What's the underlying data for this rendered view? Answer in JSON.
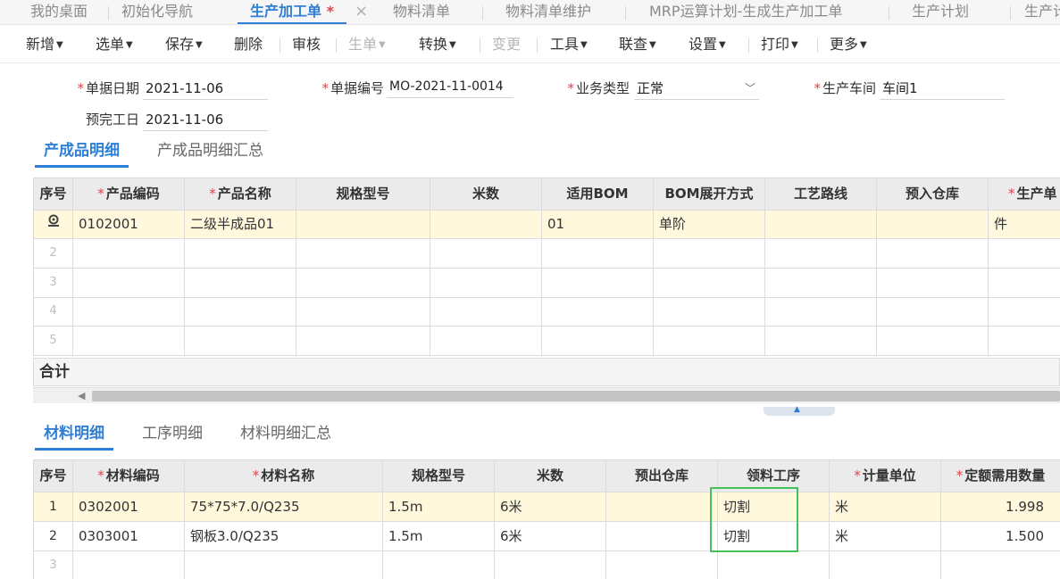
{
  "tabs": [
    {
      "label": "我的桌面",
      "active": false
    },
    {
      "label": "初始化导航",
      "active": false
    },
    {
      "label": "生产加工单",
      "active": true,
      "dirty_mark": "*"
    },
    {
      "label": "物料清单",
      "active": false
    },
    {
      "label": "物料清单维护",
      "active": false
    },
    {
      "label": "MRP运算计划-生成生产加工单",
      "active": false
    },
    {
      "label": "生产计划",
      "active": false
    },
    {
      "label": "生产计",
      "active": false
    }
  ],
  "tab_close_glyph": "×",
  "toolbar": {
    "new": "新增",
    "select_doc": "选单",
    "save": "保存",
    "delete": "删除",
    "audit": "审核",
    "generate": "生单",
    "convert": "转换",
    "change": "变更",
    "tools": "工具",
    "link_query": "联查",
    "settings": "设置",
    "print": "打印",
    "more": "更多"
  },
  "form": {
    "doc_date": {
      "label": "单据日期",
      "value": "2021-11-06"
    },
    "doc_no": {
      "label": "单据编号",
      "value": "MO-2021-11-0014"
    },
    "biz_type": {
      "label": "业务类型",
      "value": "正常"
    },
    "workshop": {
      "label": "生产车间",
      "value": "车间1"
    },
    "due_date": {
      "label": "预完工日",
      "value": "2021-11-06"
    }
  },
  "product_tabs": [
    "产成品明细",
    "产成品明细汇总"
  ],
  "product_grid": {
    "headers": [
      "序号",
      "产品编码",
      "产品名称",
      "规格型号",
      "米数",
      "适用BOM",
      "BOM展开方式",
      "工艺路线",
      "预入仓库",
      "生产单"
    ],
    "rows": [
      {
        "seq": "",
        "code": "0102001",
        "name": "二级半成品01",
        "spec": "",
        "meters": "",
        "bom": "01",
        "bom_mode": "单阶",
        "route": "",
        "warehouse": "",
        "unit": "件"
      },
      {
        "seq": "2"
      },
      {
        "seq": "3"
      },
      {
        "seq": "4"
      },
      {
        "seq": "5"
      }
    ],
    "total_label": "合计"
  },
  "material_tabs": [
    "材料明细",
    "工序明细",
    "材料明细汇总"
  ],
  "material_grid": {
    "headers": [
      "序号",
      "材料编码",
      "材料名称",
      "规格型号",
      "米数",
      "预出仓库",
      "领料工序",
      "计量单位",
      "定额需用数量"
    ],
    "rows": [
      {
        "seq": "1",
        "code": "0302001",
        "name": "75*75*7.0/Q235",
        "spec": "1.5m",
        "meters": "6米",
        "warehouse": "",
        "process": "切割",
        "unit": "米",
        "qty": "1.998"
      },
      {
        "seq": "2",
        "code": "0303001",
        "name": "钢板3.0/Q235",
        "spec": "1.5m",
        "meters": "6米",
        "warehouse": "",
        "process": "切割",
        "unit": "米",
        "qty": "1.500"
      },
      {
        "seq": "3"
      }
    ]
  },
  "colors": {
    "accent": "#2f7fd6",
    "required": "#e0424b",
    "selected_row": "#fff8dc",
    "highlight": "#43c25a"
  },
  "icons": {
    "row_settings": "gear-icon",
    "dropdown": "chevron-down-icon",
    "close": "close-icon"
  }
}
